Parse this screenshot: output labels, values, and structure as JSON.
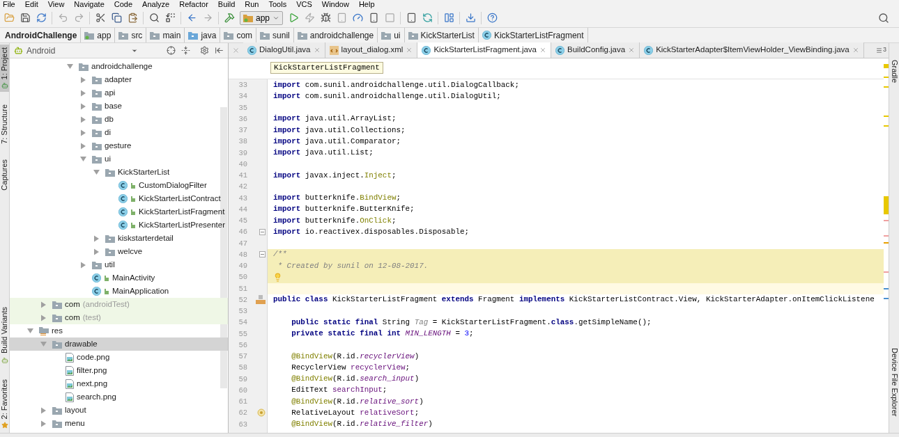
{
  "menu": [
    "File",
    "Edit",
    "View",
    "Navigate",
    "Code",
    "Analyze",
    "Refactor",
    "Build",
    "Run",
    "Tools",
    "VCS",
    "Window",
    "Help"
  ],
  "toolbar": {
    "run_config": "app"
  },
  "breadcrumbs": [
    {
      "label": "AndroidChallenge",
      "kind": "project"
    },
    {
      "label": "app",
      "kind": "module"
    },
    {
      "label": "src",
      "kind": "folder"
    },
    {
      "label": "main",
      "kind": "folder"
    },
    {
      "label": "java",
      "kind": "source"
    },
    {
      "label": "com",
      "kind": "folder"
    },
    {
      "label": "sunil",
      "kind": "folder"
    },
    {
      "label": "androidchallenge",
      "kind": "folder"
    },
    {
      "label": "ui",
      "kind": "folder"
    },
    {
      "label": "KickStarterList",
      "kind": "folder"
    },
    {
      "label": "KickStarterListFragment",
      "kind": "class"
    }
  ],
  "tool_windows_left": {
    "top": [
      {
        "label": "1: Project",
        "selected": true
      },
      {
        "label": "7: Structure",
        "selected": false
      },
      {
        "label": "Captures",
        "selected": false
      }
    ],
    "bottom": [
      {
        "label": "Build Variants",
        "selected": false
      },
      {
        "label": "2: Favorites",
        "selected": false
      }
    ]
  },
  "tool_windows_right": {
    "top": [
      {
        "label": "Gradle"
      }
    ],
    "bottom": [
      {
        "label": "Device File Explorer"
      }
    ]
  },
  "project_panel": {
    "view": "Android"
  },
  "tree": [
    {
      "children": [
        {
          "children": [
            {
              "children": [
                {
                  "label": "androidchallenge",
                  "kind": "folder",
                  "expanded": true,
                  "selected": false,
                  "children": [
                    {
                      "label": "adapter",
                      "kind": "folder",
                      "expanded": false,
                      "selected": false
                    },
                    {
                      "label": "api",
                      "kind": "folder",
                      "expanded": false,
                      "selected": false
                    },
                    {
                      "label": "base",
                      "kind": "folder",
                      "expanded": false,
                      "selected": false
                    },
                    {
                      "label": "db",
                      "kind": "folder",
                      "expanded": false,
                      "selected": false
                    },
                    {
                      "label": "di",
                      "kind": "folder",
                      "expanded": false,
                      "selected": false
                    },
                    {
                      "label": "gesture",
                      "kind": "folder",
                      "expanded": false,
                      "selected": false
                    },
                    {
                      "label": "ui",
                      "kind": "folder",
                      "expanded": true,
                      "selected": false,
                      "children": [
                        {
                          "label": "KickStarterList",
                          "kind": "folder",
                          "expanded": true,
                          "selected": false,
                          "children": [
                            {
                              "label": "CustomDialogFilter",
                              "kind": "class",
                              "selected": false
                            },
                            {
                              "label": "KickStarterListContract",
                              "kind": "class",
                              "selected": false
                            },
                            {
                              "label": "KickStarterListFragment",
                              "kind": "class",
                              "selected": false
                            },
                            {
                              "label": "KickStarterListPresenter",
                              "kind": "class",
                              "selected": false
                            }
                          ]
                        },
                        {
                          "label": "kiskstarterdetail",
                          "kind": "folder",
                          "expanded": false,
                          "selected": false
                        },
                        {
                          "label": "welcve",
                          "kind": "folder",
                          "expanded": false,
                          "selected": false
                        }
                      ]
                    },
                    {
                      "label": "util",
                      "kind": "folder",
                      "expanded": false,
                      "selected": false
                    },
                    {
                      "label": "MainActivity",
                      "kind": "class",
                      "selected": false
                    },
                    {
                      "label": "MainApplication",
                      "kind": "class",
                      "selected": false
                    }
                  ]
                }
              ]
            }
          ]
        },
        {
          "label": "com",
          "qualifier": "(androidTest)",
          "kind": "test-folder",
          "expanded": false,
          "selected": false
        },
        {
          "label": "com",
          "qualifier": "(test)",
          "kind": "test-folder",
          "expanded": false,
          "selected": false
        }
      ]
    },
    {
      "label": "res",
      "kind": "res",
      "expanded": true,
      "selected": false,
      "children": [
        {
          "label": "drawable",
          "kind": "folder",
          "expanded": true,
          "selected": true,
          "children": [
            {
              "label": "code.png",
              "kind": "image",
              "selected": false
            },
            {
              "label": "filter.png",
              "kind": "image",
              "selected": false
            },
            {
              "label": "next.png",
              "kind": "image",
              "selected": false
            },
            {
              "label": "search.png",
              "kind": "image",
              "selected": false
            }
          ]
        },
        {
          "label": "layout",
          "kind": "folder",
          "expanded": false,
          "selected": false
        },
        {
          "label": "menu",
          "kind": "folder",
          "expanded": false,
          "selected": false
        }
      ]
    }
  ],
  "tabs": [
    {
      "label": "DialogUtil.java",
      "kind": "class",
      "selected": false
    },
    {
      "label": "layout_dialog.xml",
      "kind": "xml",
      "selected": false
    },
    {
      "label": "KickStarterListFragment.java",
      "kind": "class",
      "selected": true
    },
    {
      "label": "BuildConfig.java",
      "kind": "class",
      "selected": false
    },
    {
      "label": "KickStarterAdapter$ItemViewHolder_ViewBinding.java",
      "kind": "class",
      "selected": false
    }
  ],
  "tab_overflow": {
    "count": "3"
  },
  "editor": {
    "tooltip": "KickStarterListFragment",
    "lines": [
      {
        "number": "33",
        "kind": "code",
        "tokens": [
          {
            "text": "import",
            "kind": "kw"
          },
          {
            "text": " com.sunil.androidchallenge.util.DialogCallback;",
            "kind": "plain"
          }
        ]
      },
      {
        "number": "34",
        "kind": "code",
        "tokens": [
          {
            "text": "import",
            "kind": "kw"
          },
          {
            "text": " com.sunil.androidchallenge.util.DialogUtil;",
            "kind": "plain"
          }
        ]
      },
      {
        "number": "35",
        "kind": "code"
      },
      {
        "number": "36",
        "kind": "code",
        "tokens": [
          {
            "text": "import",
            "kind": "kw"
          },
          {
            "text": " java.util.ArrayList;",
            "kind": "plain"
          }
        ]
      },
      {
        "number": "37",
        "kind": "code",
        "tokens": [
          {
            "text": "import",
            "kind": "kw"
          },
          {
            "text": " java.util.Collections;",
            "kind": "plain"
          }
        ]
      },
      {
        "number": "38",
        "kind": "code",
        "tokens": [
          {
            "text": "import",
            "kind": "kw"
          },
          {
            "text": " java.util.Comparator;",
            "kind": "plain"
          }
        ]
      },
      {
        "number": "39",
        "kind": "code",
        "tokens": [
          {
            "text": "import",
            "kind": "kw"
          },
          {
            "text": " java.util.List;",
            "kind": "plain"
          }
        ]
      },
      {
        "number": "40",
        "kind": "code"
      },
      {
        "number": "41",
        "kind": "code",
        "tokens": [
          {
            "text": "import",
            "kind": "kw"
          },
          {
            "text": " javax.inject.",
            "kind": "plain"
          },
          {
            "text": "Inject",
            "kind": "ann"
          },
          {
            "text": ";",
            "kind": "plain"
          }
        ]
      },
      {
        "number": "42",
        "kind": "code"
      },
      {
        "number": "43",
        "kind": "code",
        "tokens": [
          {
            "text": "import",
            "kind": "kw"
          },
          {
            "text": " butterknife.",
            "kind": "plain"
          },
          {
            "text": "BindView",
            "kind": "ann"
          },
          {
            "text": ";",
            "kind": "plain"
          }
        ]
      },
      {
        "number": "44",
        "kind": "code",
        "tokens": [
          {
            "text": "import",
            "kind": "kw"
          },
          {
            "text": " butterknife.ButterKnife;",
            "kind": "plain"
          }
        ]
      },
      {
        "number": "45",
        "kind": "code",
        "tokens": [
          {
            "text": "import",
            "kind": "kw"
          },
          {
            "text": " butterknife.",
            "kind": "plain"
          },
          {
            "text": "OnClick",
            "kind": "ann"
          },
          {
            "text": ";",
            "kind": "plain"
          }
        ]
      },
      {
        "number": "46",
        "kind": "code",
        "marker": {
          "kind": "fold"
        },
        "tokens": [
          {
            "text": "import",
            "kind": "kw"
          },
          {
            "text": " io.reactivex.disposables.Disposable;",
            "kind": "plain"
          }
        ]
      },
      {
        "number": "47",
        "kind": "code"
      },
      {
        "number": "48",
        "kind": "doc",
        "marker": {
          "kind": "fold"
        },
        "tokens": [
          {
            "text": "/**",
            "kind": "comment"
          }
        ]
      },
      {
        "number": "49",
        "kind": "doc",
        "tokens": [
          {
            "text": " * Created by sunil on 12-08-2017.",
            "kind": "comment"
          }
        ]
      },
      {
        "number": "50",
        "kind": "doc",
        "marker": {
          "kind": "bulb"
        }
      },
      {
        "number": "51",
        "kind": "caret"
      },
      {
        "number": "52",
        "kind": "code",
        "marker": {
          "kind": "class"
        },
        "tokens": [
          {
            "text": "public class",
            "kind": "kw"
          },
          {
            "text": " KickStarterListFragment ",
            "kind": "plain"
          },
          {
            "text": "extends",
            "kind": "kw"
          },
          {
            "text": " Fragment ",
            "kind": "plain"
          },
          {
            "text": "implements",
            "kind": "kw"
          },
          {
            "text": " KickStarterListContract.View, KickStarterAdapter.onItemClickListene",
            "kind": "plain"
          }
        ]
      },
      {
        "number": "53",
        "kind": "code"
      },
      {
        "number": "54",
        "kind": "code",
        "tokens": [
          {
            "text": "    public static final",
            "kind": "kw"
          },
          {
            "text": " String ",
            "kind": "plain"
          },
          {
            "text": "Tag",
            "kind": "unused"
          },
          {
            "text": " = KickStarterListFragment.",
            "kind": "plain"
          },
          {
            "text": "class",
            "kind": "kw"
          },
          {
            "text": ".getSimpleName();",
            "kind": "plain"
          }
        ]
      },
      {
        "number": "55",
        "kind": "code",
        "tokens": [
          {
            "text": "    private static final int ",
            "kind": "kw"
          },
          {
            "text": "MIN_LENGTH",
            "kind": "field"
          },
          {
            "text": " = ",
            "kind": "plain"
          },
          {
            "text": "3",
            "kind": "num"
          },
          {
            "text": ";",
            "kind": "plain"
          }
        ]
      },
      {
        "number": "56",
        "kind": "code"
      },
      {
        "number": "57",
        "kind": "code",
        "tokens": [
          {
            "text": "    @BindView",
            "kind": "ann"
          },
          {
            "text": "(R.id.",
            "kind": "plain"
          },
          {
            "text": "recyclerView",
            "kind": "field"
          },
          {
            "text": ")",
            "kind": "plain"
          }
        ]
      },
      {
        "number": "58",
        "kind": "code",
        "tokens": [
          {
            "text": "    RecyclerView ",
            "kind": "plain"
          },
          {
            "text": "recyclerView",
            "kind": "member"
          },
          {
            "text": ";",
            "kind": "plain"
          }
        ]
      },
      {
        "number": "59",
        "kind": "code",
        "tokens": [
          {
            "text": "    @BindView",
            "kind": "ann"
          },
          {
            "text": "(R.id.",
            "kind": "plain"
          },
          {
            "text": "search_input",
            "kind": "field"
          },
          {
            "text": ")",
            "kind": "plain"
          }
        ]
      },
      {
        "number": "60",
        "kind": "code",
        "tokens": [
          {
            "text": "    EditText ",
            "kind": "plain"
          },
          {
            "text": "searchInput",
            "kind": "member"
          },
          {
            "text": ";",
            "kind": "plain"
          }
        ]
      },
      {
        "number": "61",
        "kind": "code",
        "tokens": [
          {
            "text": "    @BindView",
            "kind": "ann"
          },
          {
            "text": "(R.id.",
            "kind": "plain"
          },
          {
            "text": "relative_sort",
            "kind": "field"
          },
          {
            "text": ")",
            "kind": "plain"
          }
        ]
      },
      {
        "number": "62",
        "kind": "code",
        "marker": {
          "kind": "circle"
        },
        "tokens": [
          {
            "text": "    RelativeLayout ",
            "kind": "plain"
          },
          {
            "text": "relativeSort",
            "kind": "member"
          },
          {
            "text": ";",
            "kind": "plain"
          }
        ]
      },
      {
        "number": "63",
        "kind": "code",
        "tokens": [
          {
            "text": "    @BindView",
            "kind": "ann"
          },
          {
            "text": "(R.id.",
            "kind": "plain"
          },
          {
            "text": "relative_filter",
            "kind": "field"
          },
          {
            "text": ")",
            "kind": "plain"
          }
        ]
      }
    ]
  }
}
